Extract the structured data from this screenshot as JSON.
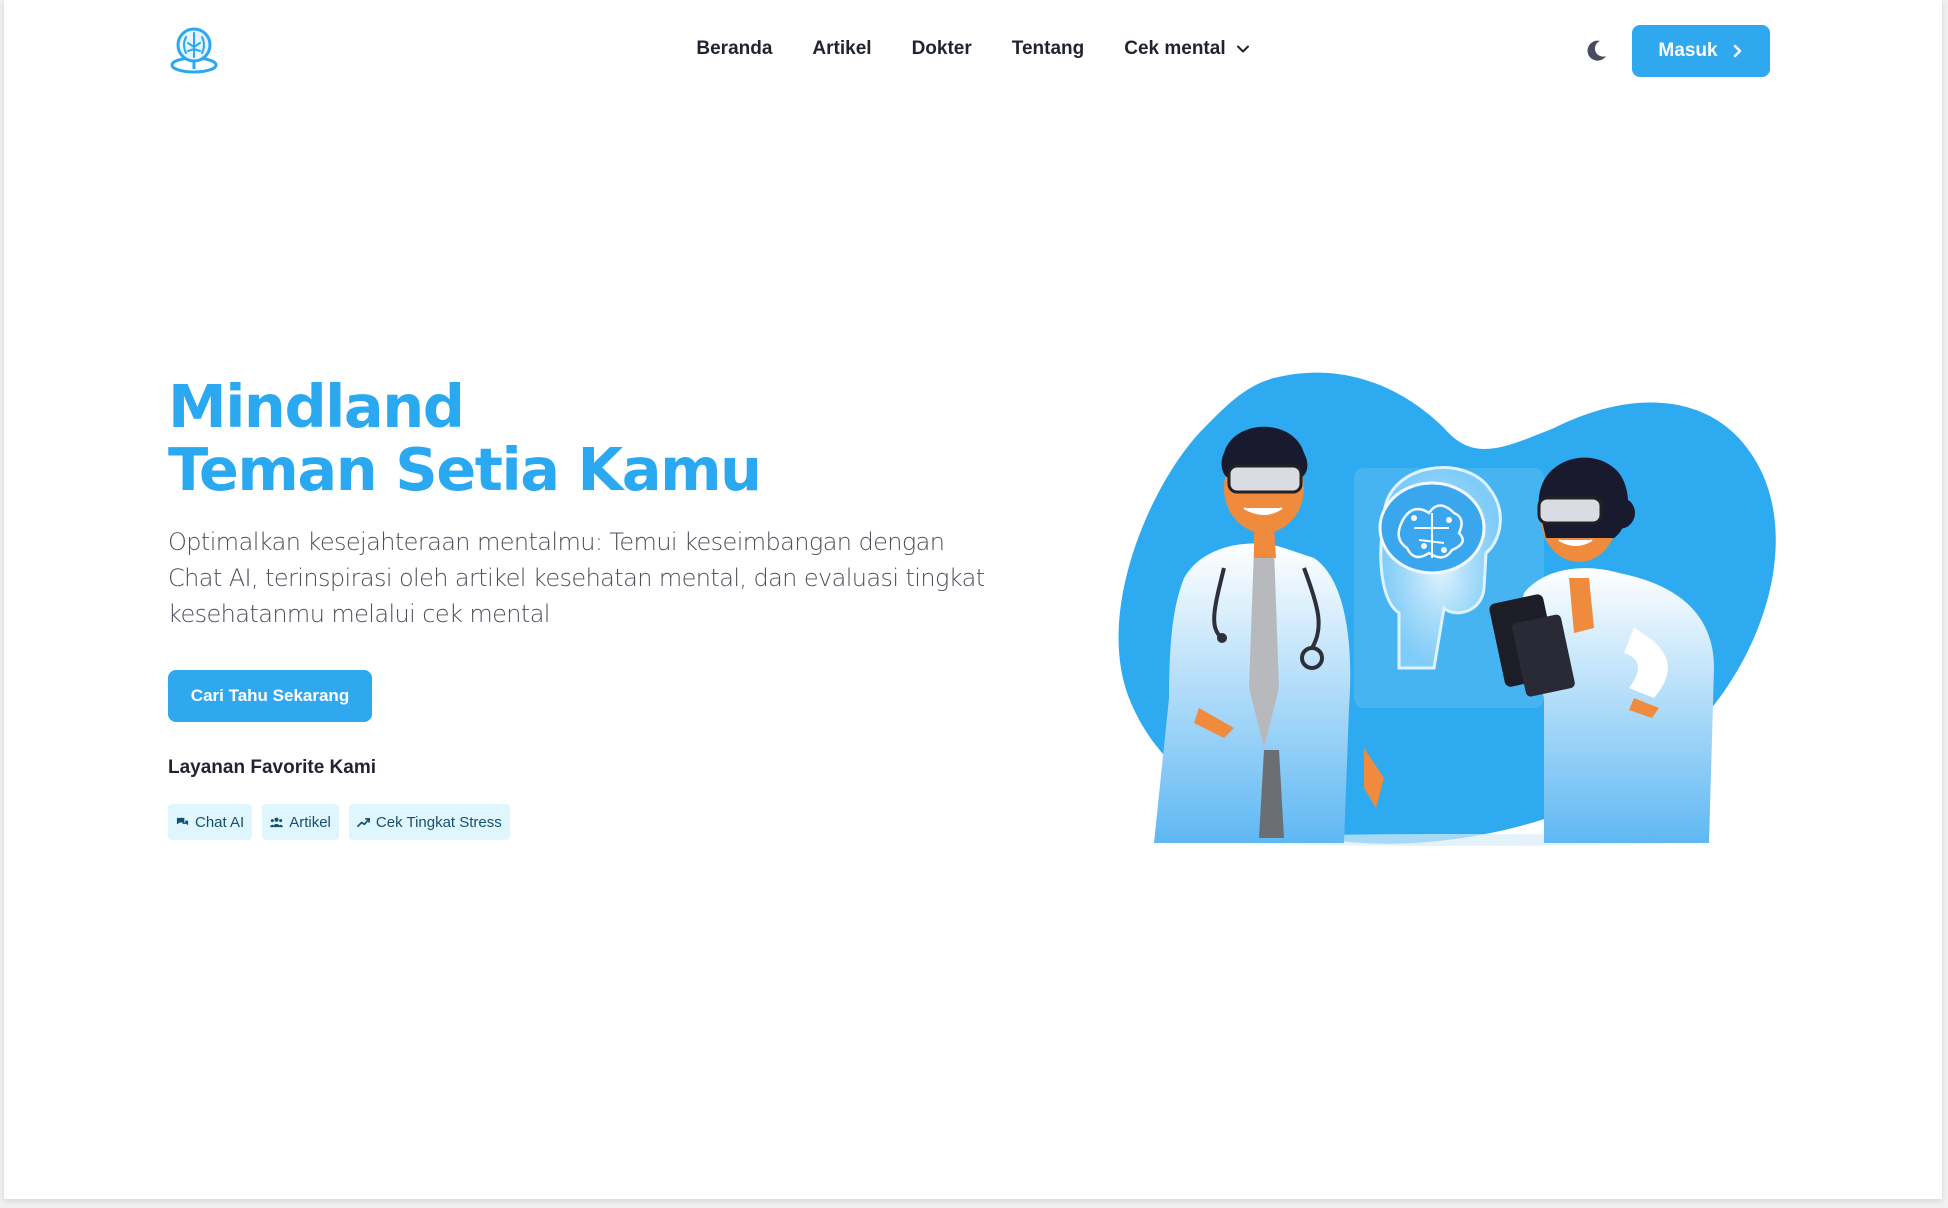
{
  "nav": {
    "logo_icon": "brain-pin-logo-icon",
    "links": [
      {
        "label": "Beranda"
      },
      {
        "label": "Artikel"
      },
      {
        "label": "Dokter"
      },
      {
        "label": "Tentang"
      },
      {
        "label": "Cek mental"
      }
    ],
    "theme_icon": "moon-icon",
    "login_label": "Masuk"
  },
  "hero": {
    "title_line1": "Mindland",
    "title_line2": "Teman Setia Kamu",
    "description": "Optimalkan kesejahteraan mentalmu: Temui keseimbangan dengan Chat AI, terinspirasi oleh artikel kesehatan mental, dan evaluasi tingkat kesehatanmu melalui cek mental",
    "cta_label": "Cari Tahu Sekarang",
    "services_heading": "Layanan Favorite Kami",
    "services": [
      {
        "label": "Chat AI",
        "icon": "chat-icon"
      },
      {
        "label": "Artikel",
        "icon": "users-icon"
      },
      {
        "label": "Cek Tingkat Stress",
        "icon": "trend-up-icon"
      }
    ]
  },
  "colors": {
    "primary": "#2fa8f0",
    "title": "#2aa9f0",
    "chip_bg": "#dff6ff",
    "text_dark": "#1f2430"
  }
}
